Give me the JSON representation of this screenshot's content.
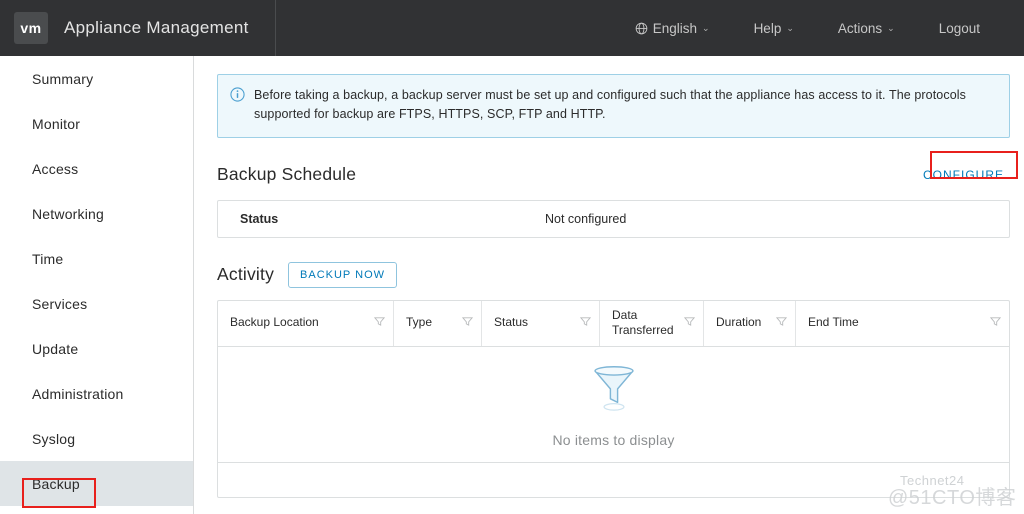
{
  "header": {
    "logo_text": "vm",
    "title": "Appliance Management",
    "nav": [
      {
        "label": "English",
        "icon": "globe-icon",
        "caret": "⌄"
      },
      {
        "label": "Help",
        "icon": "",
        "caret": "⌄"
      },
      {
        "label": "Actions",
        "icon": "",
        "caret": "⌄"
      },
      {
        "label": "Logout",
        "icon": "",
        "caret": ""
      }
    ]
  },
  "sidebar": {
    "items": [
      {
        "label": "Summary",
        "selected": false
      },
      {
        "label": "Monitor",
        "selected": false
      },
      {
        "label": "Access",
        "selected": false
      },
      {
        "label": "Networking",
        "selected": false
      },
      {
        "label": "Time",
        "selected": false
      },
      {
        "label": "Services",
        "selected": false
      },
      {
        "label": "Update",
        "selected": false
      },
      {
        "label": "Administration",
        "selected": false
      },
      {
        "label": "Syslog",
        "selected": false
      },
      {
        "label": "Backup",
        "selected": true
      }
    ]
  },
  "banner": {
    "icon": "info-circle-icon",
    "text": "Before taking a backup, a backup server must be set up and configured such that the appliance has access to it. The protocols supported for backup are FTPS, HTTPS, SCP, FTP and HTTP."
  },
  "backup_schedule": {
    "title": "Backup Schedule",
    "configure_label": "CONFIGURE",
    "status_label": "Status",
    "status_value": "Not configured"
  },
  "activity": {
    "title": "Activity",
    "backup_now_label": "BACKUP NOW",
    "columns": [
      {
        "label": "Backup Location",
        "filter_icon": "filter-icon"
      },
      {
        "label": "Type",
        "filter_icon": "filter-icon"
      },
      {
        "label": "Status",
        "filter_icon": "filter-icon"
      },
      {
        "label": "Data Transferred",
        "filter_icon": "filter-icon"
      },
      {
        "label": "Duration",
        "filter_icon": "filter-icon"
      },
      {
        "label": "End Time",
        "filter_icon": "filter-icon"
      }
    ],
    "rows": [],
    "empty_icon": "funnel-icon",
    "empty_text": "No items to display"
  },
  "watermarks": {
    "technet": "Technet24",
    "cto": "@51CTO博客"
  },
  "colors": {
    "header_bg": "#313234",
    "accent_blue": "#0079b8",
    "banner_bg": "#eef8fc",
    "banner_border": "#9ed0e6",
    "annotation_red": "#e8201c",
    "selected_item_bg": "#dfe4e7"
  }
}
